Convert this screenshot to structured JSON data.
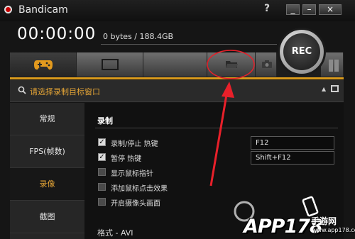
{
  "window": {
    "title": "Bandicam",
    "help_label": "?",
    "minimize_label": "_",
    "restore_label": "–",
    "close_label": "×"
  },
  "status": {
    "timer": "00:00:00",
    "size": "0 bytes / 188.4GB"
  },
  "rec": {
    "label": "REC"
  },
  "tabs": [
    {
      "name": "game-mode",
      "icon": "gamepad-icon"
    },
    {
      "name": "screen-mode",
      "icon": "screen-rectangle-icon"
    },
    {
      "name": "device-mode",
      "icon": ""
    },
    {
      "name": "folder",
      "icon": "folder-icon"
    },
    {
      "name": "screenshot",
      "icon": "camera-icon"
    },
    {
      "name": "pause",
      "icon": "pause-icon"
    }
  ],
  "search": {
    "text": "请选择录制目标窗口",
    "icon": "search-icon"
  },
  "sidebar": {
    "items": [
      {
        "label": "常规"
      },
      {
        "label": "FPS(帧数)"
      },
      {
        "label": "录像"
      },
      {
        "label": "截图"
      }
    ],
    "active_index": 2
  },
  "section": {
    "title": "录制"
  },
  "options": [
    {
      "label": "录制/停止 热键",
      "checked": true
    },
    {
      "label": "暂停 热键",
      "checked": true
    },
    {
      "label": "显示鼠标指针",
      "checked": false
    },
    {
      "label": "添加鼠标点击效果",
      "checked": false
    },
    {
      "label": "开启摄像头画面",
      "checked": false
    }
  ],
  "hotkeys": {
    "record_stop": "F12",
    "pause": "Shift+F12"
  },
  "format": {
    "label": "格式 - AVI"
  },
  "watermark": {
    "text": "APP178",
    "cn": "手游网",
    "url": "www.app178.com"
  },
  "colors": {
    "accent": "#d99a1c",
    "annotation": "#e8202a",
    "background": "#151515"
  }
}
